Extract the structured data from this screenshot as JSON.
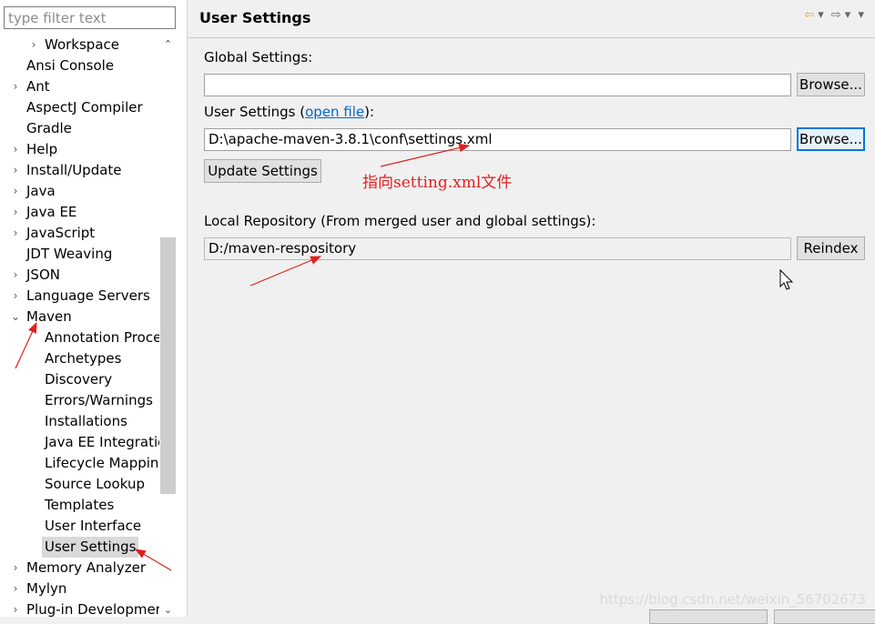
{
  "sidebar": {
    "filter_placeholder": "type filter text",
    "items": [
      {
        "label": "Workspace",
        "level": 1,
        "twisty": "›"
      },
      {
        "label": "Ansi Console",
        "level": 0,
        "twisty": ""
      },
      {
        "label": "Ant",
        "level": 0,
        "twisty": "›"
      },
      {
        "label": "AspectJ Compiler",
        "level": 0,
        "twisty": ""
      },
      {
        "label": "Gradle",
        "level": 0,
        "twisty": ""
      },
      {
        "label": "Help",
        "level": 0,
        "twisty": "›"
      },
      {
        "label": "Install/Update",
        "level": 0,
        "twisty": "›"
      },
      {
        "label": "Java",
        "level": 0,
        "twisty": "›"
      },
      {
        "label": "Java EE",
        "level": 0,
        "twisty": "›"
      },
      {
        "label": "JavaScript",
        "level": 0,
        "twisty": "›"
      },
      {
        "label": "JDT Weaving",
        "level": 0,
        "twisty": ""
      },
      {
        "label": "JSON",
        "level": 0,
        "twisty": "›"
      },
      {
        "label": "Language Servers",
        "level": 0,
        "twisty": "›"
      },
      {
        "label": "Maven",
        "level": 0,
        "twisty": "⌄"
      },
      {
        "label": "Annotation Processing",
        "level": 1,
        "twisty": ""
      },
      {
        "label": "Archetypes",
        "level": 1,
        "twisty": ""
      },
      {
        "label": "Discovery",
        "level": 1,
        "twisty": ""
      },
      {
        "label": "Errors/Warnings",
        "level": 1,
        "twisty": ""
      },
      {
        "label": "Installations",
        "level": 1,
        "twisty": ""
      },
      {
        "label": "Java EE Integration",
        "level": 1,
        "twisty": ""
      },
      {
        "label": "Lifecycle Mappings",
        "level": 1,
        "twisty": ""
      },
      {
        "label": "Source Lookup",
        "level": 1,
        "twisty": ""
      },
      {
        "label": "Templates",
        "level": 1,
        "twisty": ""
      },
      {
        "label": "User Interface",
        "level": 1,
        "twisty": ""
      },
      {
        "label": "User Settings",
        "level": 1,
        "twisty": "",
        "selected": true
      },
      {
        "label": "Memory Analyzer",
        "level": 0,
        "twisty": "›"
      },
      {
        "label": "Mylyn",
        "level": 0,
        "twisty": "›"
      },
      {
        "label": "Plug-in Development",
        "level": 0,
        "twisty": "›"
      }
    ]
  },
  "page": {
    "title": "User Settings",
    "global_label": "Global Settings:",
    "global_value": "",
    "browse1": "Browse...",
    "user_label_pre": "User Settings (",
    "user_label_link": "open file",
    "user_label_post": "):",
    "user_value": "D:\\apache-maven-3.8.1\\conf\\settings.xml",
    "browse2": "Browse...",
    "update_button": "Update Settings",
    "local_label": "Local Repository (From merged user and global settings):",
    "local_value": "D:/maven-respository",
    "reindex_button": "Reindex"
  },
  "annotation": "指向setting.xml文件",
  "watermark": "https://blog.csdn.net/weixin_56702673",
  "colors": {
    "annotation": "#e0211e",
    "link": "#0066cc",
    "focus": "#0078d7"
  }
}
